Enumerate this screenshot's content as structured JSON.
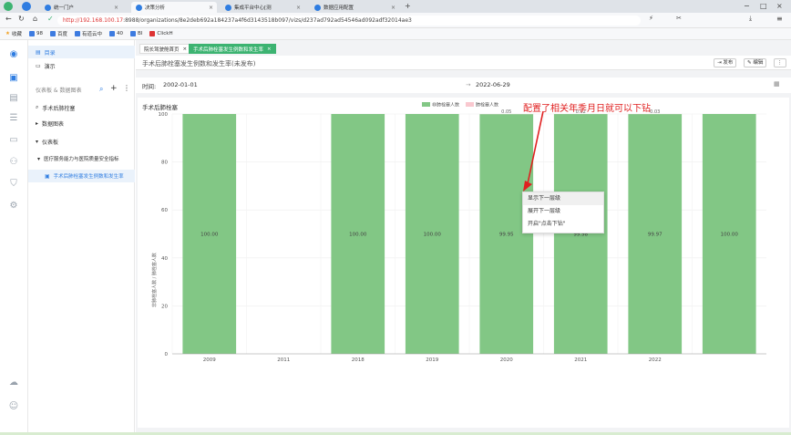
{
  "browser": {
    "tabs": [
      {
        "label": "统一门户"
      },
      {
        "label": "决策分析"
      },
      {
        "label": "集成平台中心[测"
      },
      {
        "label": "数据应用配置"
      }
    ],
    "url_prefix": "http://192.168.100.17",
    "url_rest": ":8988/organizations/8e2deb692a184237a4f6d3143518b097/vizs/d237ad792ad54546ad092adf32014ae3",
    "bookmarks": [
      {
        "label": "收藏"
      },
      {
        "label": "98"
      },
      {
        "label": "百度"
      },
      {
        "label": "有道云中"
      },
      {
        "label": "40"
      },
      {
        "label": "BI"
      },
      {
        "label": "ClickH"
      }
    ]
  },
  "tree": {
    "items": [
      {
        "label": "目录"
      },
      {
        "label": "演示"
      },
      {
        "label": "仪表板 & 数据图表"
      },
      {
        "label": "手术后肺栓塞"
      },
      {
        "label": "数据图表"
      },
      {
        "label": "仪表板"
      },
      {
        "label": "医疗服务能力与医院质量安全指标"
      },
      {
        "label": "手术后肺栓塞发生例数和发生率"
      }
    ]
  },
  "main": {
    "tabs": [
      {
        "label": "院长驾驶舱首页"
      },
      {
        "label": "手术后肺栓塞发生例数和发生率"
      }
    ],
    "title": "手术后肺栓塞发生例数和发生率(未发布)",
    "publish": "发布",
    "edit": "编辑",
    "filter_label": "时间:",
    "date_from": "2002-01-01",
    "date_sep": "→",
    "date_to": "2022-06-29"
  },
  "context_menu": {
    "items": [
      {
        "label": "显示下一层级"
      },
      {
        "label": "展开下一层级"
      },
      {
        "label": "开启\"点击下钻\""
      }
    ]
  },
  "annotation": "配置了相关年季月日就可以下钻",
  "colors": {
    "accent": "#3cb371",
    "bar_green": "#82c785",
    "bar_pink": "#f9c8cf"
  },
  "chart_data": {
    "type": "bar",
    "title": "手术后肺栓塞",
    "ylabel": "非肺栓塞人数 / 肺栓塞人数",
    "categories": [
      "2009",
      "2011",
      "2018",
      "2019",
      "2020",
      "2021",
      "2022",
      ""
    ],
    "series": [
      {
        "name": "非肺栓塞人数",
        "values": [
          100,
          null,
          100,
          100,
          99.95,
          99.98,
          99.97,
          100
        ]
      },
      {
        "name": "肺栓塞人数",
        "values": [
          0,
          null,
          0,
          0,
          0.05,
          0.02,
          0.03,
          0
        ]
      }
    ],
    "bar_labels": [
      "100.00",
      "",
      "100.00",
      "100.00",
      "99.95",
      "99.98",
      "99.97",
      "100.00"
    ],
    "top_labels": [
      "",
      "",
      "",
      "",
      "0.05",
      "0.02",
      "0.03",
      ""
    ],
    "yticks": [
      "0",
      "20",
      "40",
      "60",
      "80",
      "100"
    ],
    "ylim": [
      0,
      100
    ],
    "stacked": true,
    "legend_position": "top-right"
  }
}
